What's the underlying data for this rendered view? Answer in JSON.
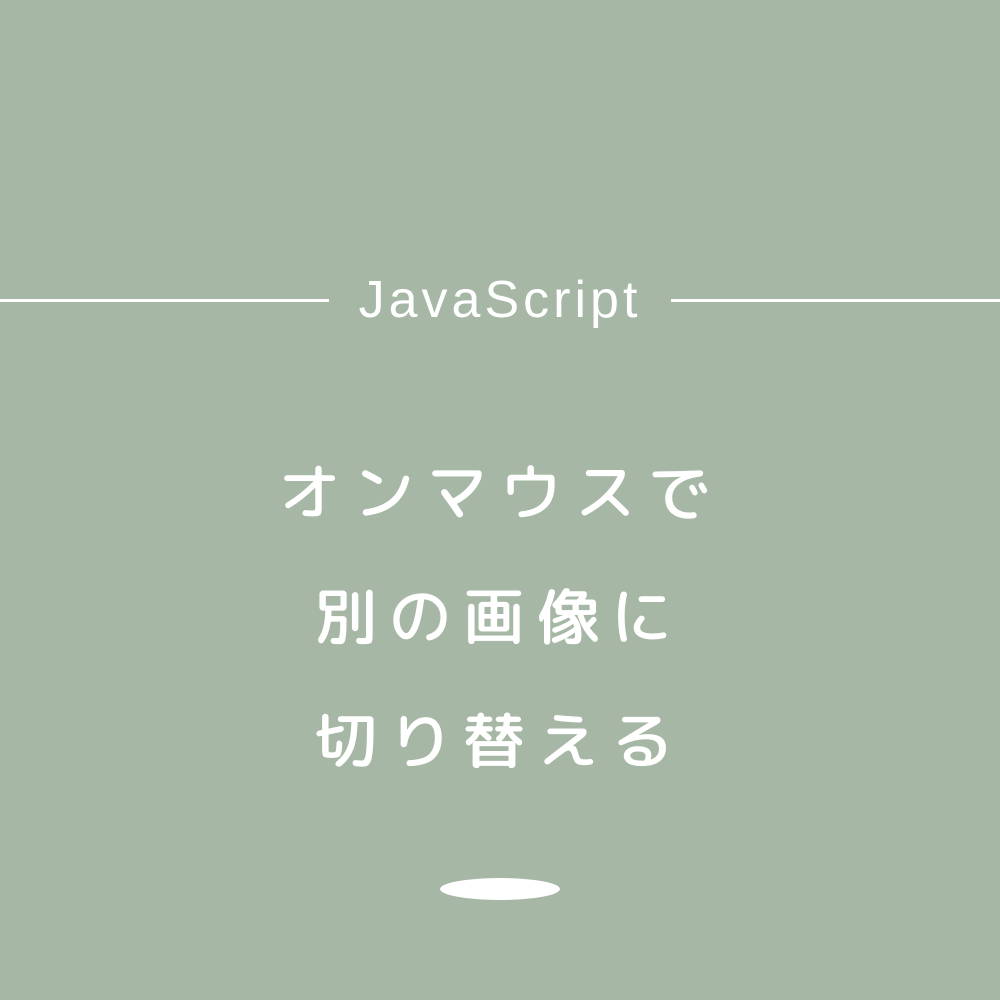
{
  "category": "JavaScript",
  "title": {
    "line1": "オンマウスで",
    "line2": "別の画像に",
    "line3": "切り替える"
  },
  "colors": {
    "background": "#a6b7a5",
    "text": "#ffffff"
  }
}
